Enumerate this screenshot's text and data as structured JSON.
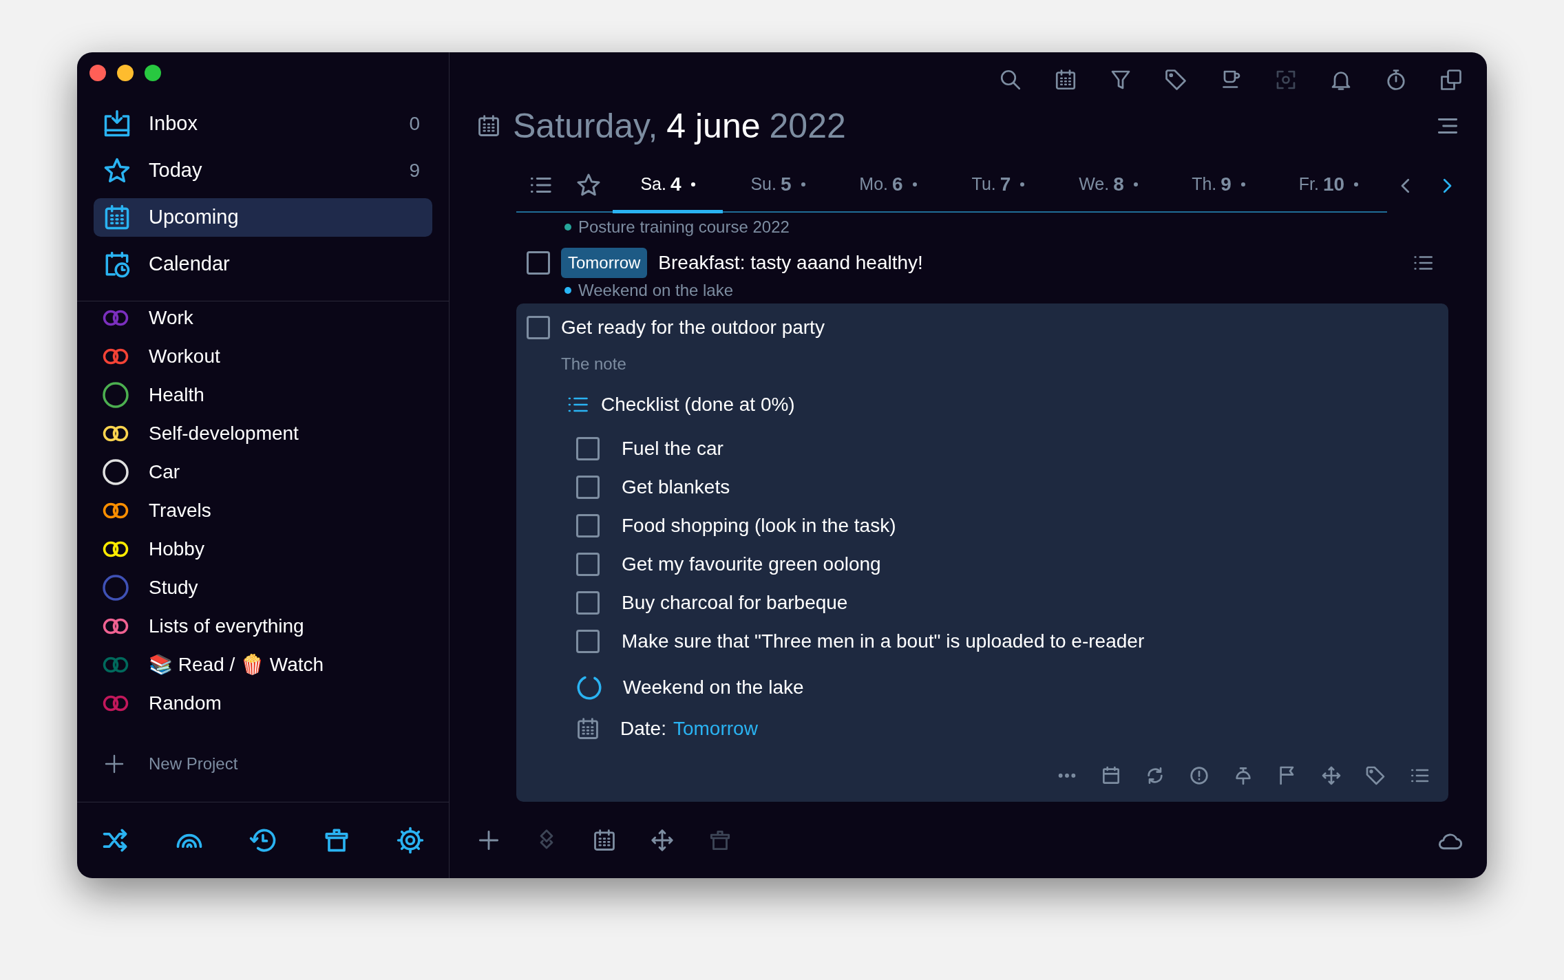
{
  "sidebar": {
    "nav": [
      {
        "kind": "inbox",
        "label": "Inbox",
        "count": "0",
        "selected": false
      },
      {
        "kind": "today",
        "label": "Today",
        "count": "9",
        "selected": false
      },
      {
        "kind": "upcoming",
        "label": "Upcoming",
        "selected": true
      },
      {
        "kind": "calendar",
        "label": "Calendar",
        "selected": false
      }
    ],
    "projects": [
      {
        "kind": "linked",
        "label": "Work",
        "color": "#7b2fbe"
      },
      {
        "kind": "linked",
        "label": "Workout",
        "color": "#f44336"
      },
      {
        "kind": "ring",
        "label": "Health",
        "color": "#4caf50"
      },
      {
        "kind": "linked",
        "label": "Self-development",
        "color": "#fdd54f"
      },
      {
        "kind": "ring",
        "label": "Car",
        "color": "#e0e0e0"
      },
      {
        "kind": "linked",
        "label": "Travels",
        "color": "#ff8f00"
      },
      {
        "kind": "linked",
        "label": "Hobby",
        "color": "#ffeb00"
      },
      {
        "kind": "ring",
        "label": "Study",
        "color": "#3f51b5"
      },
      {
        "kind": "linked",
        "label": "Lists of everything",
        "color": "#f06292"
      },
      {
        "kind": "linked",
        "label": "📚 Read / 🍿 Watch",
        "color": "#00695c"
      },
      {
        "kind": "linked",
        "label": "Random",
        "color": "#c2185b"
      }
    ],
    "new_project": "New Project"
  },
  "main": {
    "title": {
      "weekday": "Saturday,",
      "date": "4 june",
      "year": "2022"
    },
    "days": [
      {
        "weekday": "Sa.",
        "day": "4",
        "selected": true
      },
      {
        "weekday": "Su.",
        "day": "5",
        "selected": false
      },
      {
        "weekday": "Mo.",
        "day": "6",
        "selected": false
      },
      {
        "weekday": "Tu.",
        "day": "7",
        "selected": false
      },
      {
        "weekday": "We.",
        "day": "8",
        "selected": false
      },
      {
        "weekday": "Th.",
        "day": "9",
        "selected": false
      },
      {
        "weekday": "Fr.",
        "day": "10",
        "selected": false
      }
    ],
    "tasks": [
      {
        "project": "Posture training course 2022",
        "color": "#26a69a"
      },
      {
        "checked": false,
        "badge": "Tomorrow",
        "title": "Breakfast: tasty aaand healthy!",
        "project": "Weekend on the lake",
        "color": "#29b6f6"
      }
    ],
    "open_task": {
      "checked": false,
      "title": "Get ready for the outdoor party",
      "note": "The note",
      "checklist_title": "Checklist (done at 0%)",
      "checklist": [
        {
          "label": "Fuel the car",
          "checked": false
        },
        {
          "label": "Get blankets",
          "checked": false
        },
        {
          "label": "Food shopping (look in the task)",
          "checked": false
        },
        {
          "label": "Get my favourite green oolong",
          "checked": false
        },
        {
          "label": "Buy charcoal for barbeque",
          "checked": false
        },
        {
          "label": "Make sure that \"Three men in a bout\" is uploaded to e-reader",
          "checked": false
        }
      ],
      "project": "Weekend on the lake",
      "date_label": "Date:",
      "date": "Tomorrow"
    }
  }
}
